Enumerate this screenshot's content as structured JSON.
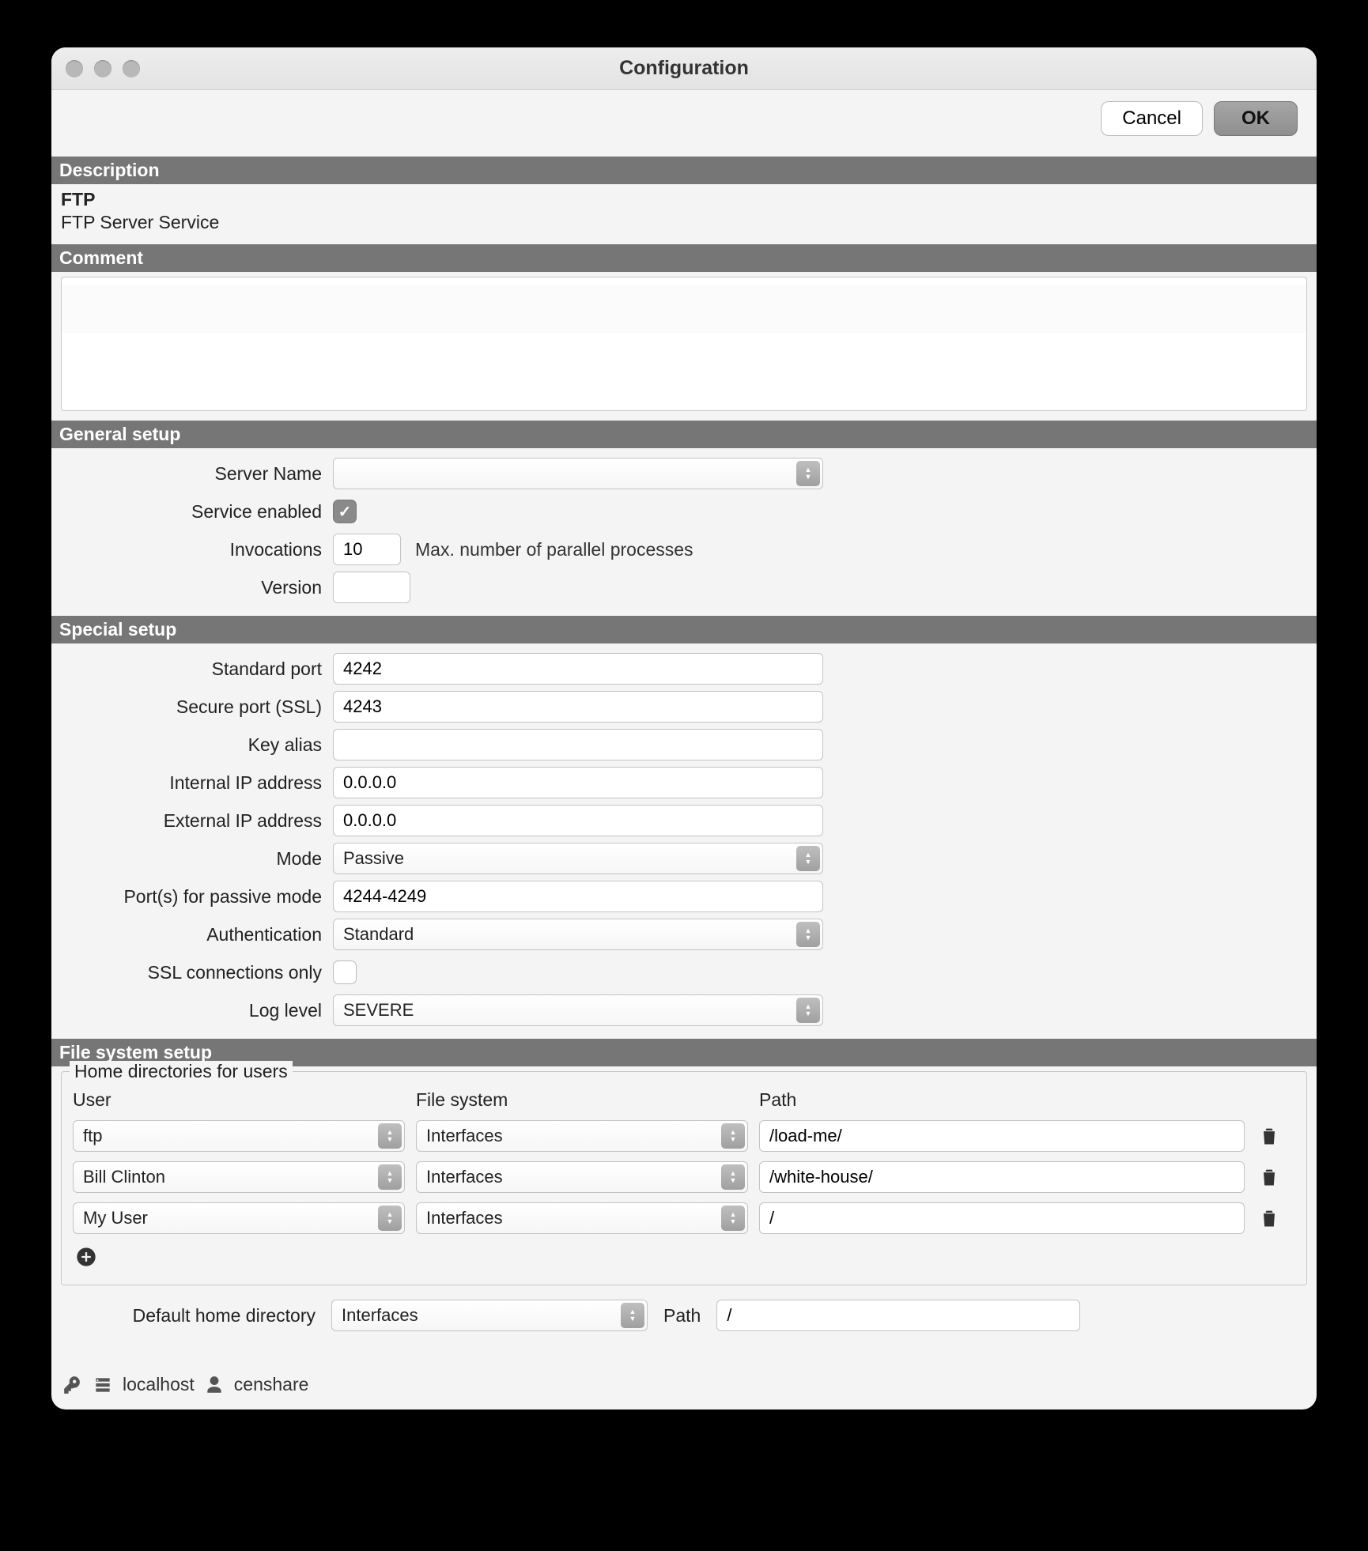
{
  "window": {
    "title": "Configuration"
  },
  "toolbar": {
    "cancel": "Cancel",
    "ok": "OK"
  },
  "sections": {
    "description": "Description",
    "comment": "Comment",
    "general": "General  setup",
    "special": "Special  setup",
    "filesystem": "File system setup"
  },
  "description": {
    "title": "FTP",
    "subtitle": "FTP Server Service"
  },
  "general": {
    "server_name_label": "Server Name",
    "server_name_value": "",
    "service_enabled_label": "Service enabled",
    "service_enabled": true,
    "invocations_label": "Invocations",
    "invocations_value": "10",
    "invocations_hint": "Max. number of parallel processes",
    "version_label": "Version",
    "version_value": ""
  },
  "special": {
    "standard_port_label": "Standard port",
    "standard_port_value": "4242",
    "secure_port_label": "Secure port (SSL)",
    "secure_port_value": "4243",
    "key_alias_label": "Key alias",
    "key_alias_value": "",
    "internal_ip_label": "Internal IP address",
    "internal_ip_value": "0.0.0.0",
    "external_ip_label": "External IP address",
    "external_ip_value": "0.0.0.0",
    "mode_label": "Mode",
    "mode_value": "Passive",
    "passive_ports_label": "Port(s) for passive mode",
    "passive_ports_value": "4244-4249",
    "auth_label": "Authentication",
    "auth_value": "Standard",
    "ssl_only_label": "SSL connections only",
    "ssl_only": false,
    "log_level_label": "Log level",
    "log_level_value": "SEVERE"
  },
  "fs": {
    "legend": "Home directories for users",
    "col_user": "User",
    "col_fs": "File system",
    "col_path": "Path",
    "rows": [
      {
        "user": "ftp",
        "fs": "Interfaces",
        "path": "/load-me/"
      },
      {
        "user": "Bill Clinton",
        "fs": "Interfaces",
        "path": "/white-house/"
      },
      {
        "user": "My User",
        "fs": "Interfaces",
        "path": "/"
      }
    ],
    "default_label": "Default home directory",
    "default_fs": "Interfaces",
    "default_path_label": "Path",
    "default_path_value": "/"
  },
  "footer": {
    "host": "localhost",
    "user": "censhare"
  }
}
